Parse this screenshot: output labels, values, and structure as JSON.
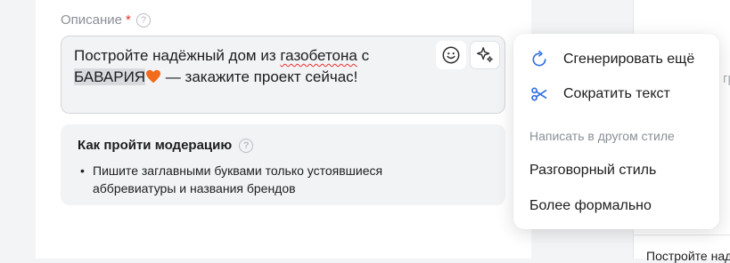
{
  "field": {
    "label": "Описание",
    "required_mark": "*",
    "help_icon": "question-circle-icon",
    "help_glyph": "?"
  },
  "textarea": {
    "line1_start": "Постройте надёжный дом из ",
    "line1_misspelled": "газобетона",
    "line1_end": " с",
    "selected_word": "БАВАРИЯ",
    "emoji": "orange-heart",
    "line2_rest": " — закажите проект сейчас!",
    "emoji_button_icon": "smiley-icon",
    "ai_button_icon": "sparkles-icon"
  },
  "moderation": {
    "title": "Как пройти модерацию",
    "help_glyph": "?",
    "bullet": "•",
    "tips": [
      "Пишите заглавными буквами только устоявшиеся аббревиатуры и названия брендов"
    ]
  },
  "menu": {
    "items": [
      {
        "label": "Сгенерировать ещё",
        "icon": "refresh-icon"
      },
      {
        "label": "Сократить текст",
        "icon": "scissors-icon"
      }
    ],
    "section_title": "Написать в другом стиле",
    "style_items": [
      {
        "label": "Разговорный стиль"
      },
      {
        "label": "Более формально"
      }
    ]
  },
  "right_panel": {
    "fragment": "гру",
    "bottom_text": "Постройте над"
  },
  "colors": {
    "accent": "#2f6fe0",
    "required": "#e5322d",
    "heart": "#f26b1d"
  }
}
